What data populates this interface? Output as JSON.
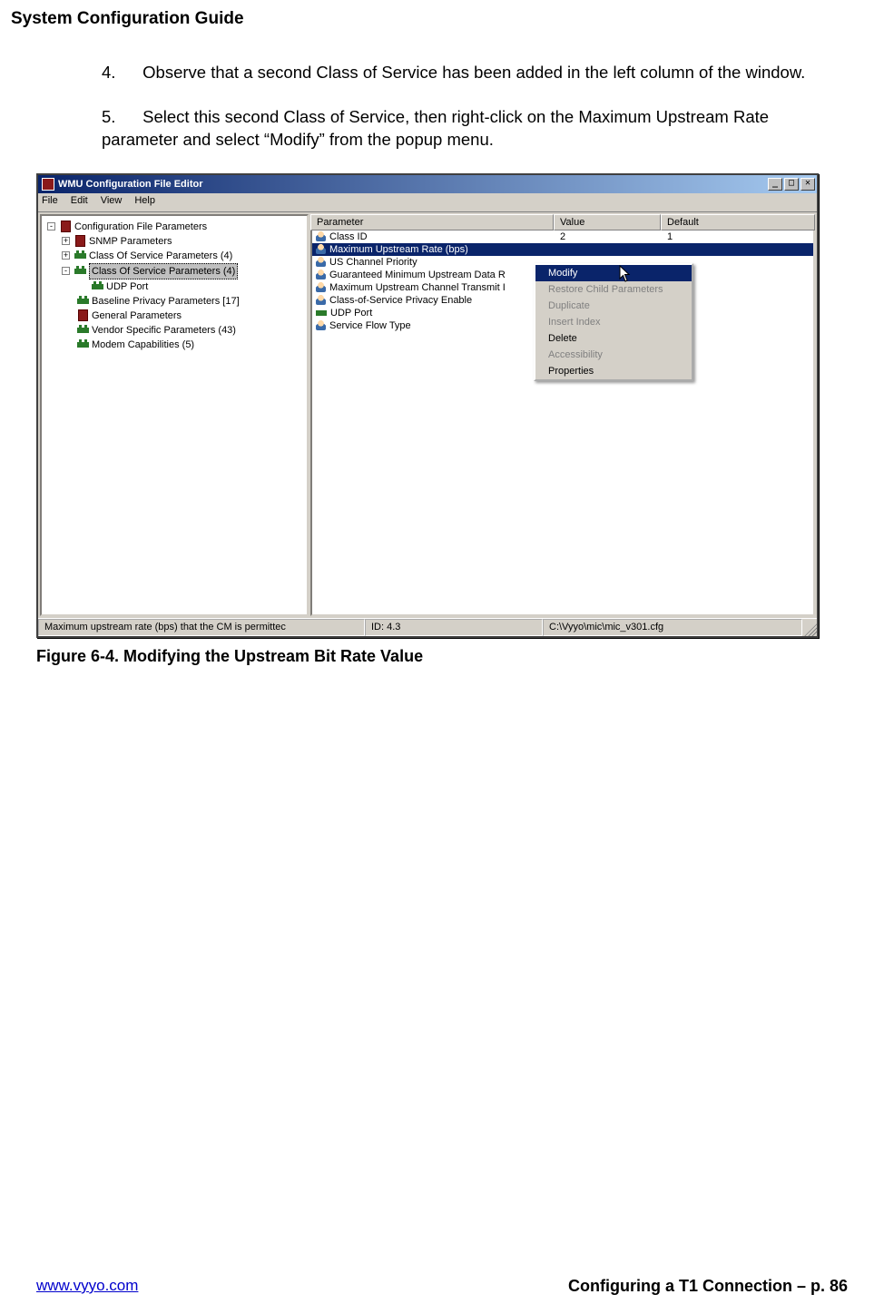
{
  "doc_title": "System Configuration Guide",
  "step4_num": "4.",
  "step4_text": "Observe that a second Class of Service has been added in the left column of the window.",
  "step5_num": "5.",
  "step5_text": "Select this second Class of Service, then right-click on the Maximum Upstream Rate parameter and select “Modify” from the popup menu.",
  "figure_caption": "Figure 6-4. Modifying the Upstream Bit Rate Value",
  "window_title": "WMU Configuration File Editor",
  "menu": {
    "file": "File",
    "edit": "Edit",
    "view": "View",
    "help": "Help"
  },
  "win_buttons": {
    "min": "_",
    "max": "□",
    "close": "✕"
  },
  "tree": {
    "n0": "Configuration File Parameters",
    "n1": "SNMP Parameters",
    "n2": "Class Of Service Parameters (4)",
    "n3": "Class Of Service Parameters (4)",
    "n4": "UDP Port",
    "n5": "Baseline Privacy Parameters [17]",
    "n6": "General Parameters",
    "n7": "Vendor Specific Parameters (43)",
    "n8": "Modem Capabilities (5)"
  },
  "columns": {
    "param": "Parameter",
    "value": "Value",
    "default": "Default"
  },
  "rows": {
    "r0": {
      "p": "Class ID",
      "v": "2",
      "d": "1"
    },
    "r1": {
      "p": "Maximum Upstream Rate (bps)"
    },
    "r2": {
      "p": "US Channel Priority"
    },
    "r3": {
      "p": "Guaranteed Minimum Upstream Data R"
    },
    "r4": {
      "p": "Maximum Upstream Channel Transmit I"
    },
    "r5": {
      "p": "Class-of-Service Privacy Enable"
    },
    "r6": {
      "p": "UDP Port"
    },
    "r7": {
      "p": "Service Flow Type"
    }
  },
  "ctx": {
    "modify": "Modify",
    "restore": "Restore Child Parameters",
    "dup": "Duplicate",
    "insert": "Insert Index",
    "delete": "Delete",
    "access": "Accessibility",
    "props": "Properties"
  },
  "status": {
    "s1": "Maximum upstream rate (bps) that the CM is permittec",
    "s2": "ID: 4.3",
    "s3": "C:\\Vyyo\\mic\\mic_v301.cfg"
  },
  "footer": {
    "link": "www.vyyo.com",
    "right": "Configuring a T1 Connection – p. 86"
  }
}
